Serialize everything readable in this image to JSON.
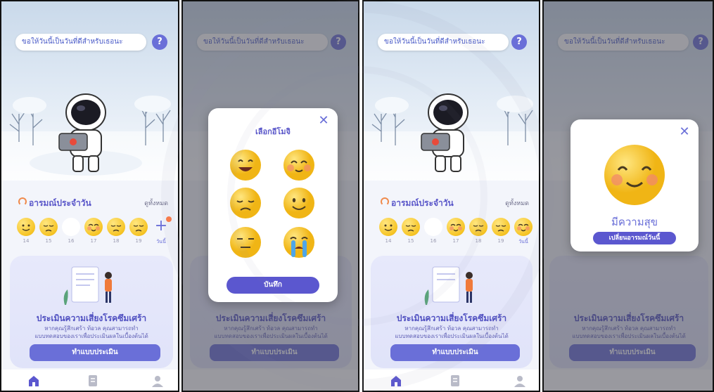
{
  "greeting": "ขอให้วันนี้เป็นวันที่ดีสำหรับเธอนะ",
  "help_label": "?",
  "mood_section": {
    "title": "อารมณ์ประจำวัน",
    "see_all": "ดูทั้งหมด"
  },
  "week_before": [
    {
      "day": "14",
      "mood": "smile"
    },
    {
      "day": "15",
      "mood": "sad"
    },
    {
      "day": "16",
      "mood": "none"
    },
    {
      "day": "17",
      "mood": "blush"
    },
    {
      "day": "18",
      "mood": "sad"
    },
    {
      "day": "19",
      "mood": "sad"
    }
  ],
  "today_label": "วันนี้",
  "today_add": "+",
  "assessment": {
    "title": "ประเมินความเสี่ยงโรคซึมเศร้า",
    "desc_line1": "หากคุณรู้สึกเศร้า ท้อวล คุณสามารถทำ",
    "desc_line2": "แบบทดสอบของเราเพื่อประเมินผลในเบื้องต้นได้",
    "button": "ทำแบบประเมิน"
  },
  "picker_modal": {
    "title": "เลือกอีโมจิ",
    "close": "✕",
    "save": "บันทึก",
    "options": [
      "laugh",
      "blush",
      "sad",
      "smile",
      "neutral",
      "cry"
    ]
  },
  "result_modal": {
    "close": "✕",
    "mood": "มีความสุข",
    "change": "เปลี่ยนอารมณ์วันนี้"
  },
  "nav": [
    "home-icon",
    "document-icon",
    "profile-icon"
  ],
  "colors": {
    "accent": "#6a6fd8",
    "primary_button": "#5b57cf",
    "emoji_yellow": "#f6c425",
    "card_bg": "#e4e6fa"
  }
}
